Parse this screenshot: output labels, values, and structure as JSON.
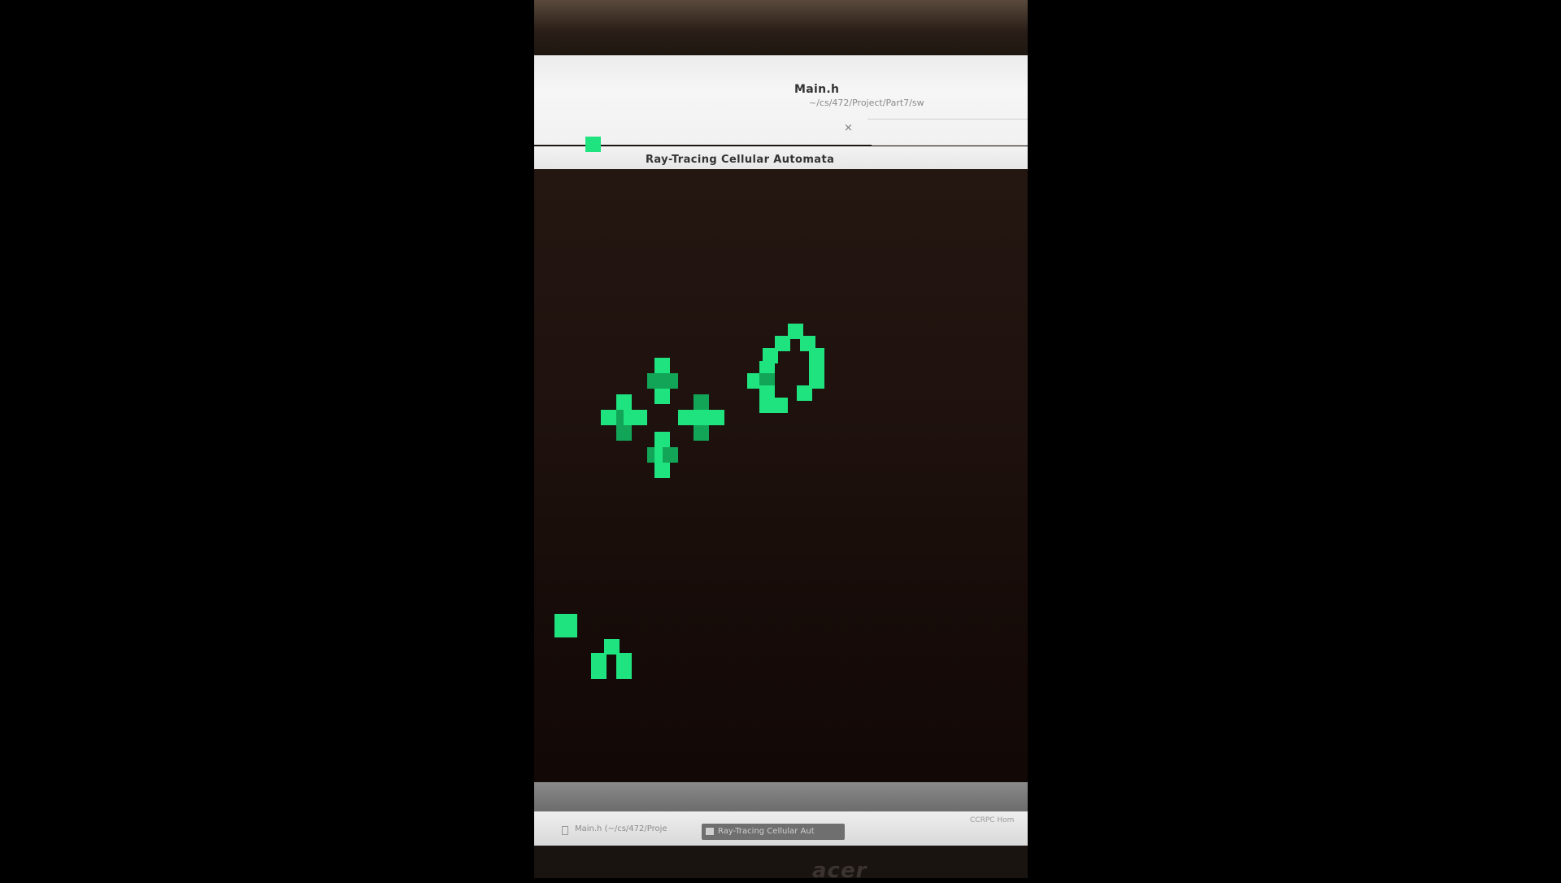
{
  "editor": {
    "title": "Main.h",
    "path": "~/cs/472/Project/Part7/sw",
    "close_glyph": "×"
  },
  "window": {
    "title": "Ray-Tracing Cellular Automata"
  },
  "simulation": {
    "background": "#1f120e",
    "cell_colors": {
      "bright": "#1fe37e",
      "dim": "#12a558"
    }
  },
  "taskbar": {
    "items": [
      {
        "label": "Main.h (~/cs/472/Proje"
      },
      {
        "label": "Ray-Tracing Cellular Aut"
      }
    ],
    "clock": "CCRPC Hom"
  },
  "monitor": {
    "brand": "acer"
  }
}
